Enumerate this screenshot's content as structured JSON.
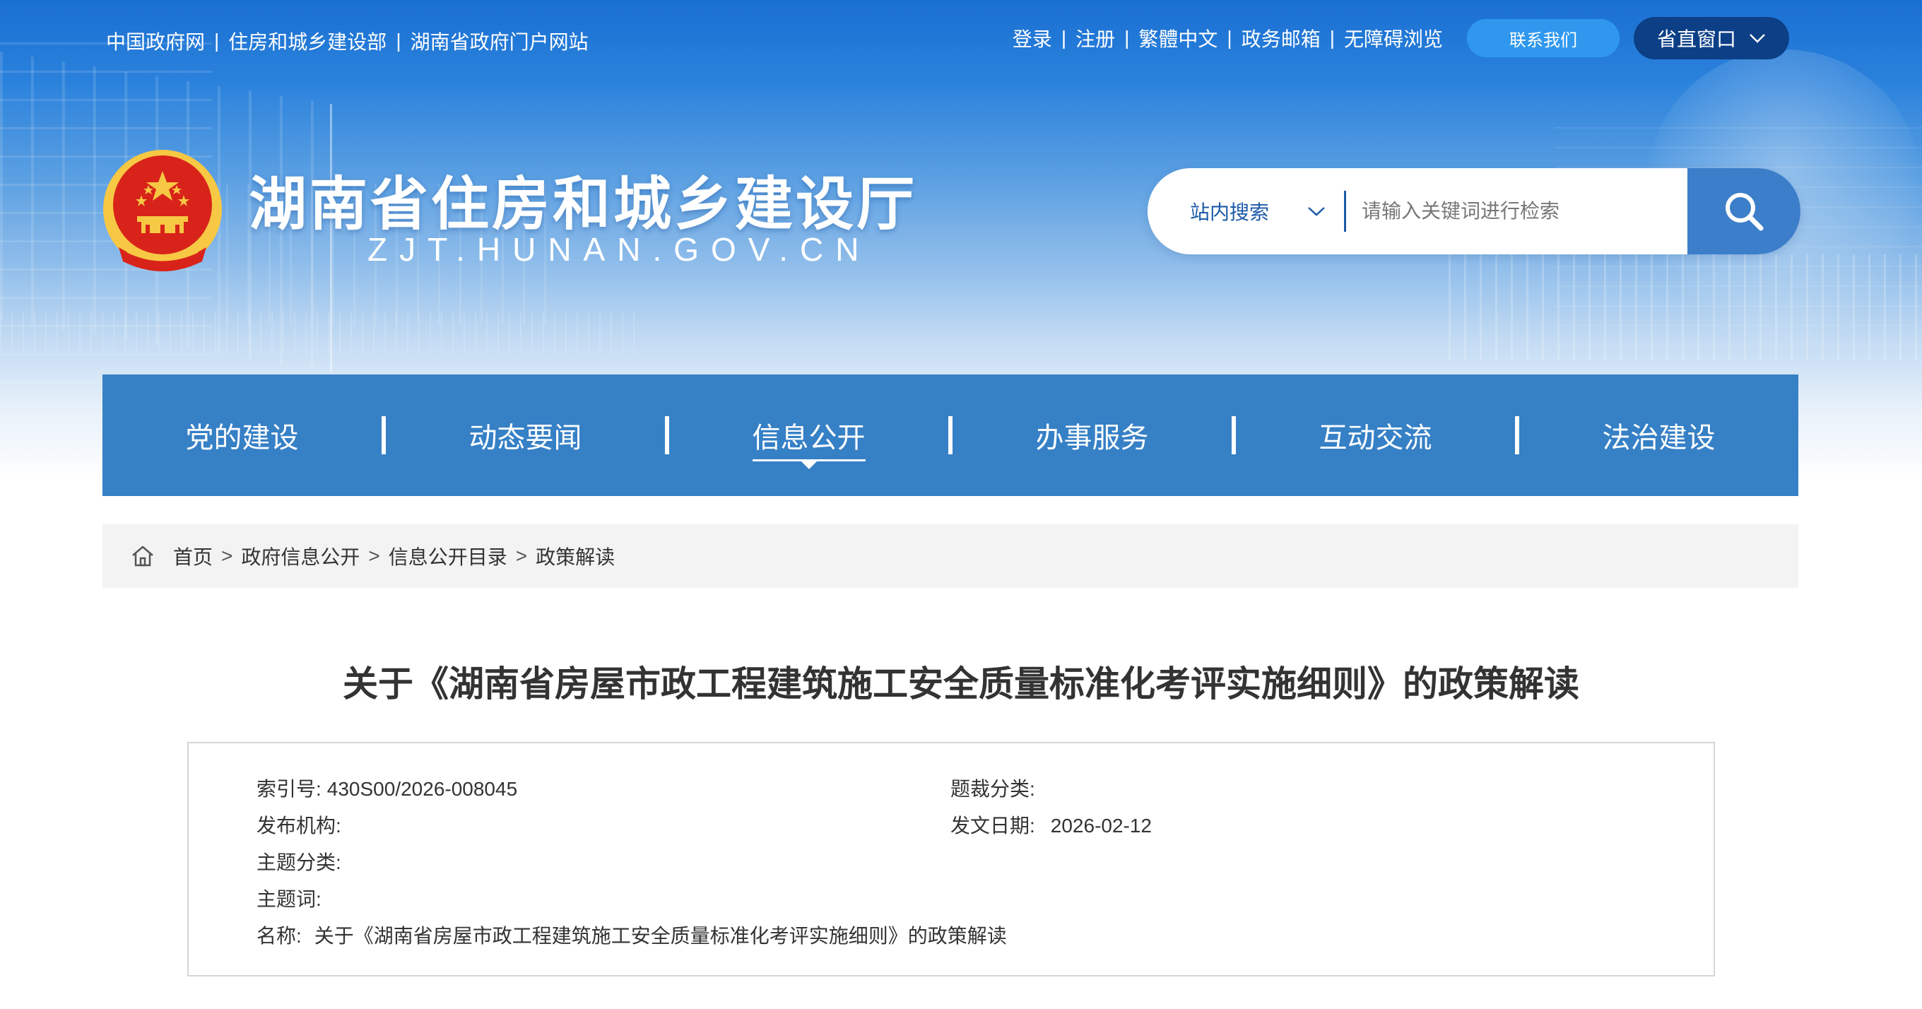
{
  "top_links": [
    "中国政府网",
    "住房和城乡建设部",
    "湖南省政府门户网站"
  ],
  "right_links": [
    "登录",
    "注册",
    "繁體中文",
    "政务邮箱",
    "无障碍浏览"
  ],
  "separator": "|",
  "contact_label": "联系我们",
  "window_label": "省直窗口",
  "site": {
    "title": "湖南省住房和城乡建设厅",
    "domain": "ZJT.HUNAN.GOV.CN"
  },
  "search": {
    "scope": "站内搜索",
    "placeholder": "请输入关键词进行检索"
  },
  "nav": {
    "items": [
      {
        "label": "党的建设"
      },
      {
        "label": "动态要闻"
      },
      {
        "label": "信息公开",
        "active": true
      },
      {
        "label": "办事服务"
      },
      {
        "label": "互动交流"
      },
      {
        "label": "法治建设"
      }
    ]
  },
  "breadcrumb": {
    "items": [
      "首页",
      "政府信息公开",
      "信息公开目录",
      "政策解读"
    ],
    "sep": ">"
  },
  "article": {
    "title": "关于《湖南省房屋市政工程建筑施工安全质量标准化考评实施细则》的政策解读"
  },
  "meta": {
    "index_label": "索引号:",
    "index_value": "430S00/2026-008045",
    "category_label": "题裁分类:",
    "publisher_label": "发布机构:",
    "date_label": "发文日期:",
    "date_value": "2026-02-12",
    "topic_label": "主题分类:",
    "keywords_label": "主题词:",
    "name_label": "名称:",
    "name_value": "关于《湖南省房屋市政工程建筑施工安全质量标准化考评实施细则》的政策解读"
  },
  "colors": {
    "nav_bg": "#3680c6",
    "search_button": "#3c7ec9",
    "window_button": "#0c3f86",
    "contact_button": "#2f98ee",
    "breadcrumb_bg": "#f3f3f3",
    "emblem_red": "#d8231a",
    "emblem_gold": "#f6c843"
  }
}
